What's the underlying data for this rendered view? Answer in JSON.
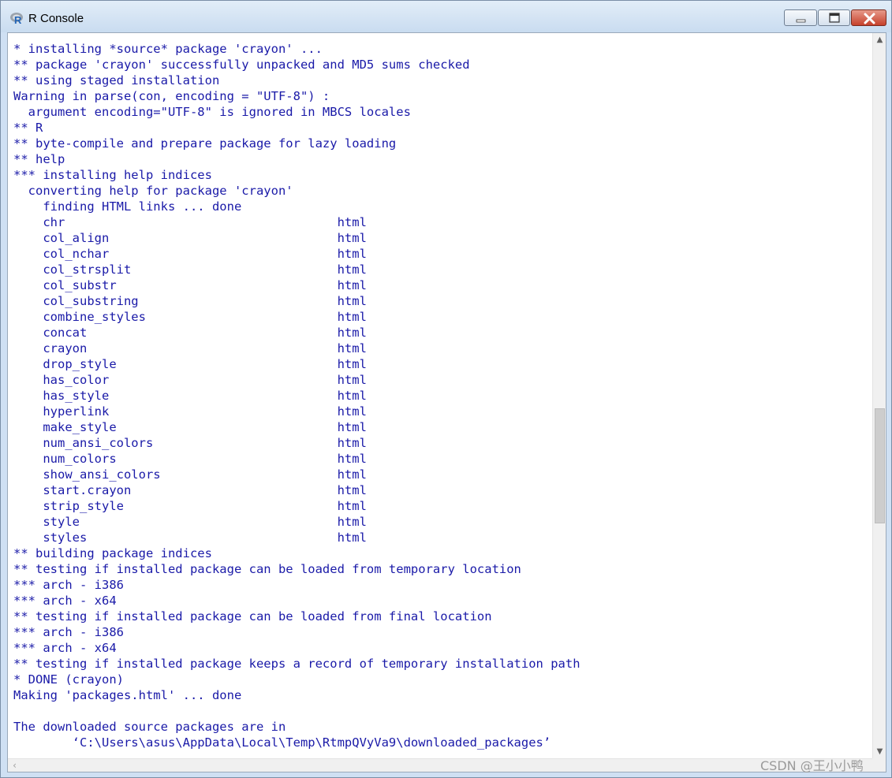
{
  "window": {
    "title": "R Console",
    "icon": "r-logo-icon",
    "controls": [
      "minimize-icon",
      "maximize-icon",
      "close-icon"
    ]
  },
  "console": {
    "lines": [
      "* installing *source* package 'crayon' ...",
      "** package 'crayon' successfully unpacked and MD5 sums checked",
      "** using staged installation",
      "Warning in parse(con, encoding = \"UTF-8\") :",
      "  argument encoding=\"UTF-8\" is ignored in MBCS locales",
      "** R",
      "** byte-compile and prepare package for lazy loading",
      "** help",
      "*** installing help indices",
      "  converting help for package 'crayon'",
      "    finding HTML links ... done",
      "    chr                                     html",
      "    col_align                               html",
      "    col_nchar                               html",
      "    col_strsplit                            html",
      "    col_substr                              html",
      "    col_substring                           html",
      "    combine_styles                          html",
      "    concat                                  html",
      "    crayon                                  html",
      "    drop_style                              html",
      "    has_color                               html",
      "    has_style                               html",
      "    hyperlink                               html",
      "    make_style                              html",
      "    num_ansi_colors                         html",
      "    num_colors                              html",
      "    show_ansi_colors                        html",
      "    start.crayon                            html",
      "    strip_style                             html",
      "    style                                   html",
      "    styles                                  html",
      "** building package indices",
      "** testing if installed package can be loaded from temporary location",
      "*** arch - i386",
      "*** arch - x64",
      "** testing if installed package can be loaded from final location",
      "*** arch - i386",
      "*** arch - x64",
      "** testing if installed package keeps a record of temporary installation path",
      "* DONE (crayon)",
      "Making 'packages.html' ... done",
      "",
      "The downloaded source packages are in",
      "        ‘C:\\Users\\asus\\AppData\\Local\\Temp\\RtmpQVyVa9\\downloaded_packages’"
    ],
    "text_color": "#1a1aa8",
    "background": "#ffffff"
  },
  "scrollbars": {
    "up_arrow": "▲",
    "down_arrow": "▼",
    "left_arrow": "‹",
    "vertical_position": 0.62
  },
  "watermark": "CSDN @王小小鸭"
}
